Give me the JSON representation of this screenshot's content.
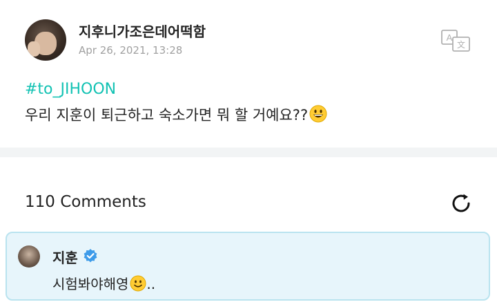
{
  "post": {
    "author_name": "지후니가조은데어떡함",
    "timestamp": "Apr 26, 2021, 13:28",
    "hashtag": "#to_JIHOON",
    "text": "우리 지훈이 퇴근하고 숙소가면 뭐 할 거예요??",
    "text_emoji": "grinning-face-emoji",
    "translate_icon": "translate-icon"
  },
  "comments": {
    "count_label": "110 Comments",
    "refresh_icon": "refresh-icon",
    "items": [
      {
        "author": "지훈",
        "verified": true,
        "text": "시험봐야해영",
        "text_emoji": "slightly-smiling-face-emoji",
        "text_suffix": ".."
      }
    ]
  },
  "colors": {
    "hashtag": "#12c2b3",
    "comment_bg": "#e7f5fb",
    "comment_border": "#b9e3ef",
    "verified": "#3d9be9",
    "divider": "#f2f4f5"
  }
}
